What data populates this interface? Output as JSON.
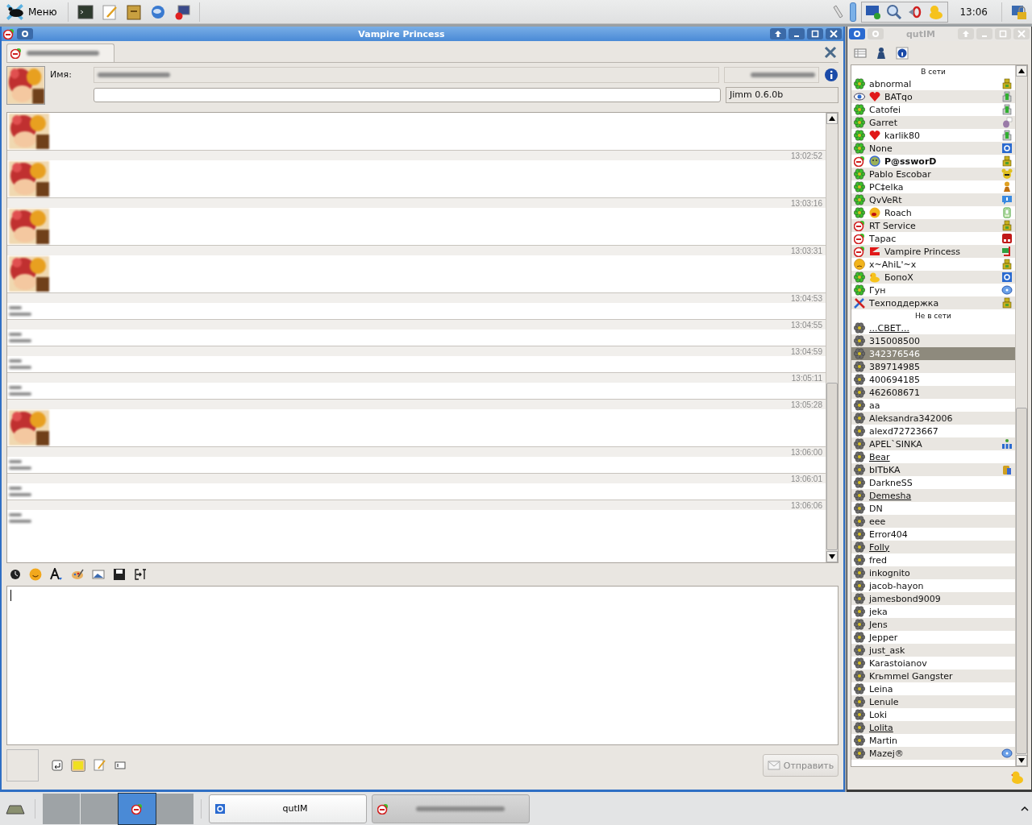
{
  "top_panel": {
    "menu_label": "Меню",
    "clock": "13:06"
  },
  "chat_window": {
    "title": "Vampire Princess",
    "name_label": "Имя:",
    "client": "Jimm 0.6.0b",
    "messages": [
      {
        "avatar": true,
        "time": "13:02:52"
      },
      {
        "avatar": true,
        "time": "13:03:16"
      },
      {
        "avatar": true,
        "time": "13:03:31"
      },
      {
        "avatar": true,
        "time": "13:04:53"
      },
      {
        "avatar": false,
        "time": "13:04:55"
      },
      {
        "avatar": false,
        "time": "13:04:59"
      },
      {
        "avatar": false,
        "time": "13:05:11"
      },
      {
        "avatar": false,
        "time": "13:05:28"
      },
      {
        "avatar": true,
        "time": "13:06:00"
      },
      {
        "avatar": false,
        "time": "13:06:01"
      },
      {
        "avatar": false,
        "time": "13:06:06"
      },
      {
        "avatar": false
      }
    ],
    "send_button": {
      "label": "Отправить",
      "disabled": true
    }
  },
  "contact_window": {
    "title": "qutIM",
    "groups": [
      {
        "label": "В сети",
        "contacts": [
          {
            "name": "abnormal",
            "status_icon": {
              "kind": "online"
            },
            "client_icon": {
              "kind": "jimm"
            },
            "bold": false,
            "selected": false
          },
          {
            "name": "BATqo",
            "status_icon": {
              "kind": "eye"
            },
            "extra_icon": {
              "kind": "heart"
            },
            "client_icon": {
              "kind": "mobile"
            },
            "bold": false,
            "selected": false
          },
          {
            "name": "Catofei",
            "status_icon": {
              "kind": "online"
            },
            "client_icon": {
              "kind": "mobile"
            },
            "bold": false,
            "selected": false
          },
          {
            "name": "Garret",
            "status_icon": {
              "kind": "online"
            },
            "client_icon": {
              "kind": "bird"
            },
            "bold": false,
            "selected": false
          },
          {
            "name": "karlik80",
            "status_icon": {
              "kind": "online"
            },
            "extra_icon": {
              "kind": "heart"
            },
            "client_icon": {
              "kind": "mobile"
            },
            "bold": false,
            "selected": false
          },
          {
            "name": "None",
            "status_icon": {
              "kind": "online"
            },
            "client_icon": {
              "kind": "qip"
            },
            "bold": false,
            "selected": false
          },
          {
            "name": "P@ssworD",
            "status_icon": {
              "kind": "na"
            },
            "extra_icon": {
              "kind": "face"
            },
            "client_icon": {
              "kind": "jimm"
            },
            "bold": true,
            "selected": false
          },
          {
            "name": "Pablo Escobar",
            "status_icon": {
              "kind": "online"
            },
            "client_icon": {
              "kind": "mouse"
            },
            "bold": false,
            "selected": false
          },
          {
            "name": "PC‡elka",
            "status_icon": {
              "kind": "online"
            },
            "client_icon": {
              "kind": "figure"
            },
            "bold": false,
            "selected": false
          },
          {
            "name": "QvVeRt",
            "status_icon": {
              "kind": "online"
            },
            "client_icon": {
              "kind": "chat"
            },
            "bold": false,
            "selected": false
          },
          {
            "name": "Roach",
            "status_icon": {
              "kind": "online"
            },
            "extra_icon": {
              "kind": "smiley"
            },
            "client_icon": {
              "kind": "pda"
            },
            "bold": false,
            "selected": false
          },
          {
            "name": "RT Service",
            "status_icon": {
              "kind": "na"
            },
            "client_icon": {
              "kind": "jimm"
            },
            "bold": false,
            "selected": false
          },
          {
            "name": "Тарас",
            "status_icon": {
              "kind": "na"
            },
            "client_icon": {
              "kind": "rq"
            },
            "bold": false,
            "selected": false
          },
          {
            "name": "Vampire Princess",
            "status_icon": {
              "kind": "na"
            },
            "extra_icon": {
              "kind": "flag"
            },
            "client_icon": {
              "kind": "computer"
            },
            "bold": false,
            "selected": false
          },
          {
            "name": "x~AhiL'~x",
            "status_icon": {
              "kind": "away"
            },
            "client_icon": {
              "kind": "jimm"
            },
            "bold": false,
            "selected": false
          },
          {
            "name": "БопоX",
            "status_icon": {
              "kind": "online"
            },
            "extra_icon": {
              "kind": "duck"
            },
            "client_icon": {
              "kind": "qip"
            },
            "bold": false,
            "selected": false
          },
          {
            "name": "Гун",
            "status_icon": {
              "kind": "online"
            },
            "client_icon": {
              "kind": "disc"
            },
            "bold": false,
            "selected": false
          },
          {
            "name": "Техподдержка",
            "status_icon": {
              "kind": "tools"
            },
            "client_icon": {
              "kind": "jimm"
            },
            "bold": false,
            "selected": false
          }
        ]
      },
      {
        "label": "Не в сети",
        "contacts": [
          {
            "name": "...СВЕТ...",
            "status_icon": {
              "kind": "offline"
            },
            "underlined": true,
            "selected": false
          },
          {
            "name": "315008500",
            "status_icon": {
              "kind": "offline"
            },
            "underlined": false,
            "selected": false
          },
          {
            "name": "342376546",
            "status_icon": {
              "kind": "offline"
            },
            "underlined": false,
            "selected": true
          },
          {
            "name": "389714985",
            "status_icon": {
              "kind": "offline"
            },
            "underlined": false,
            "selected": false
          },
          {
            "name": "400694185",
            "status_icon": {
              "kind": "offline"
            },
            "underlined": false,
            "selected": false
          },
          {
            "name": "462608671",
            "status_icon": {
              "kind": "offline"
            },
            "underlined": false,
            "selected": false
          },
          {
            "name": "aa",
            "status_icon": {
              "kind": "offline"
            },
            "underlined": false,
            "selected": false
          },
          {
            "name": "Aleksandra342006",
            "status_icon": {
              "kind": "offline"
            },
            "underlined": false,
            "selected": false
          },
          {
            "name": "alexd72723667",
            "status_icon": {
              "kind": "offline"
            },
            "underlined": false,
            "selected": false
          },
          {
            "name": "APEL`SINKA",
            "status_icon": {
              "kind": "offline"
            },
            "client_icon": {
              "kind": "mip"
            },
            "underlined": false,
            "selected": false
          },
          {
            "name": "Bear",
            "status_icon": {
              "kind": "offline"
            },
            "underlined": true,
            "selected": false
          },
          {
            "name": "bITbKA",
            "status_icon": {
              "kind": "offline"
            },
            "client_icon": {
              "kind": "handset"
            },
            "underlined": false,
            "selected": false
          },
          {
            "name": "DarkneSS",
            "status_icon": {
              "kind": "offline"
            },
            "underlined": false,
            "selected": false
          },
          {
            "name": "Demesha",
            "status_icon": {
              "kind": "offline"
            },
            "underlined": true,
            "selected": false
          },
          {
            "name": "DN",
            "status_icon": {
              "kind": "offline"
            },
            "underlined": false,
            "selected": false
          },
          {
            "name": "eee",
            "status_icon": {
              "kind": "offline"
            },
            "underlined": false,
            "selected": false
          },
          {
            "name": "Error404",
            "status_icon": {
              "kind": "offline"
            },
            "underlined": false,
            "selected": false
          },
          {
            "name": "Folly",
            "status_icon": {
              "kind": "offline"
            },
            "underlined": true,
            "selected": false
          },
          {
            "name": "fred",
            "status_icon": {
              "kind": "offline"
            },
            "underlined": false,
            "selected": false
          },
          {
            "name": "inkognito",
            "status_icon": {
              "kind": "offline"
            },
            "underlined": false,
            "selected": false
          },
          {
            "name": "jacob-hayon",
            "status_icon": {
              "kind": "offline"
            },
            "underlined": false,
            "selected": false
          },
          {
            "name": "jamesbond9009",
            "status_icon": {
              "kind": "offline"
            },
            "underlined": false,
            "selected": false
          },
          {
            "name": "jeka",
            "status_icon": {
              "kind": "offline"
            },
            "underlined": false,
            "selected": false
          },
          {
            "name": "Jens",
            "status_icon": {
              "kind": "offline"
            },
            "underlined": false,
            "selected": false
          },
          {
            "name": "Jepper",
            "status_icon": {
              "kind": "offline"
            },
            "underlined": false,
            "selected": false
          },
          {
            "name": "just_ask",
            "status_icon": {
              "kind": "offline"
            },
            "underlined": false,
            "selected": false
          },
          {
            "name": "Karastoianov",
            "status_icon": {
              "kind": "offline"
            },
            "underlined": false,
            "selected": false
          },
          {
            "name": "Krьmmel Gangster",
            "status_icon": {
              "kind": "offline"
            },
            "underlined": false,
            "selected": false
          },
          {
            "name": "Leina",
            "status_icon": {
              "kind": "offline"
            },
            "underlined": false,
            "selected": false
          },
          {
            "name": "Lenule",
            "status_icon": {
              "kind": "offline"
            },
            "underlined": false,
            "selected": false
          },
          {
            "name": "Loki",
            "status_icon": {
              "kind": "offline"
            },
            "underlined": false,
            "selected": false
          },
          {
            "name": "Lolita",
            "status_icon": {
              "kind": "offline"
            },
            "underlined": true,
            "selected": false
          },
          {
            "name": "Martin",
            "status_icon": {
              "kind": "offline"
            },
            "underlined": false,
            "selected": false
          },
          {
            "name": "Mazej®",
            "status_icon": {
              "kind": "offline"
            },
            "client_icon": {
              "kind": "disc"
            },
            "underlined": false,
            "selected": false
          }
        ]
      }
    ]
  },
  "taskbar": {
    "desktops": [
      {
        "selected": false
      },
      {
        "selected": false
      },
      {
        "selected": true
      },
      {
        "selected": false
      }
    ],
    "tasks": [
      {
        "label": "qutIM",
        "selected": false
      },
      {
        "selected": true
      }
    ]
  }
}
